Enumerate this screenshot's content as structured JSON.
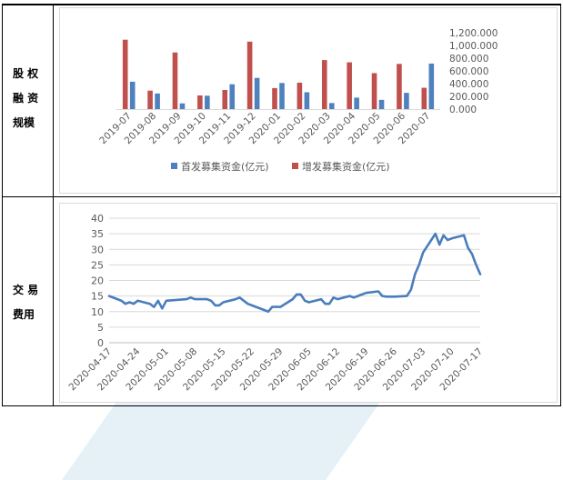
{
  "rows": [
    {
      "label_lines": [
        "股 权",
        "融 资",
        "规模"
      ]
    },
    {
      "label_lines": [
        "交 易",
        "费用"
      ]
    }
  ],
  "colors": {
    "first": "#4e81bd",
    "additional": "#c0504d",
    "line": "#4a7ebb",
    "grid": "#d9d9d9",
    "axis_text": "#595959"
  },
  "chart_data": [
    {
      "type": "bar",
      "categories": [
        "2019-07",
        "2019-08",
        "2019-09",
        "2019-10",
        "2019-11",
        "2019-12",
        "2020-01",
        "2020-02",
        "2020-03",
        "2020-04",
        "2020-05",
        "2020-06",
        "2020-07"
      ],
      "series": [
        {
          "name": "首发募集资金(亿元)",
          "values": [
            430,
            245,
            90,
            210,
            390,
            490,
            410,
            265,
            95,
            180,
            145,
            255,
            715
          ]
        },
        {
          "name": "增发募集资金(亿元)",
          "values": [
            1090,
            290,
            890,
            215,
            300,
            1060,
            330,
            415,
            770,
            735,
            565,
            710,
            335
          ]
        }
      ],
      "ylim": [
        0,
        1200
      ],
      "yticks": [
        "0.000",
        "200.000",
        "400.000",
        "600.000",
        "800.000",
        "1,000.000",
        "1,200.000"
      ],
      "y_axis_side": "right",
      "legend": "bottom",
      "grid": false
    },
    {
      "type": "line",
      "x": [
        "2020-04-17",
        "2020-04-20",
        "2020-04-21",
        "2020-04-22",
        "2020-04-23",
        "2020-04-24",
        "2020-04-27",
        "2020-04-28",
        "2020-04-29",
        "2020-04-30",
        "2020-05-01",
        "2020-05-06",
        "2020-05-07",
        "2020-05-08",
        "2020-05-11",
        "2020-05-12",
        "2020-05-13",
        "2020-05-14",
        "2020-05-15",
        "2020-05-18",
        "2020-05-19",
        "2020-05-20",
        "2020-05-21",
        "2020-05-22",
        "2020-05-25",
        "2020-05-26",
        "2020-05-27",
        "2020-05-28",
        "2020-05-29",
        "2020-06-01",
        "2020-06-02",
        "2020-06-03",
        "2020-06-04",
        "2020-06-05",
        "2020-06-08",
        "2020-06-09",
        "2020-06-10",
        "2020-06-11",
        "2020-06-12",
        "2020-06-15",
        "2020-06-16",
        "2020-06-17",
        "2020-06-18",
        "2020-06-19",
        "2020-06-22",
        "2020-06-23",
        "2020-06-24",
        "2020-06-25",
        "2020-06-26",
        "2020-06-29",
        "2020-06-30",
        "2020-07-01",
        "2020-07-02",
        "2020-07-03",
        "2020-07-06",
        "2020-07-07",
        "2020-07-08",
        "2020-07-09",
        "2020-07-10",
        "2020-07-13",
        "2020-07-14",
        "2020-07-15",
        "2020-07-16",
        "2020-07-17"
      ],
      "series": [
        {
          "name": "",
          "values": [
            15,
            13.5,
            12.5,
            13,
            12.5,
            13.5,
            12.5,
            11.5,
            13.5,
            11,
            13.5,
            14,
            14.5,
            14,
            14,
            13.5,
            12,
            12,
            13,
            14,
            14.5,
            13.5,
            12.5,
            12,
            10.5,
            10,
            11.5,
            11.5,
            11.5,
            14,
            15.5,
            15.5,
            13.5,
            13,
            14,
            12.5,
            12.5,
            14.5,
            14,
            15,
            14.5,
            15,
            15.5,
            16,
            16.5,
            15,
            14.8,
            14.8,
            14.8,
            15,
            17,
            22,
            25,
            29,
            35,
            31.5,
            34.5,
            33,
            33.5,
            34.5,
            30.5,
            28.5,
            25,
            22
          ]
        }
      ],
      "xticks": [
        "2020-04-17",
        "2020-04-24",
        "2020-05-01",
        "2020-05-08",
        "2020-05-15",
        "2020-05-22",
        "2020-05-29",
        "2020-06-05",
        "2020-06-12",
        "2020-06-19",
        "2020-06-26",
        "2020-07-03",
        "2020-07-10",
        "2020-07-17"
      ],
      "ylim": [
        0,
        40
      ],
      "yticks": [
        "0",
        "5",
        "10",
        "15",
        "20",
        "25",
        "30",
        "35",
        "40"
      ],
      "grid": true,
      "legend": "none"
    }
  ]
}
